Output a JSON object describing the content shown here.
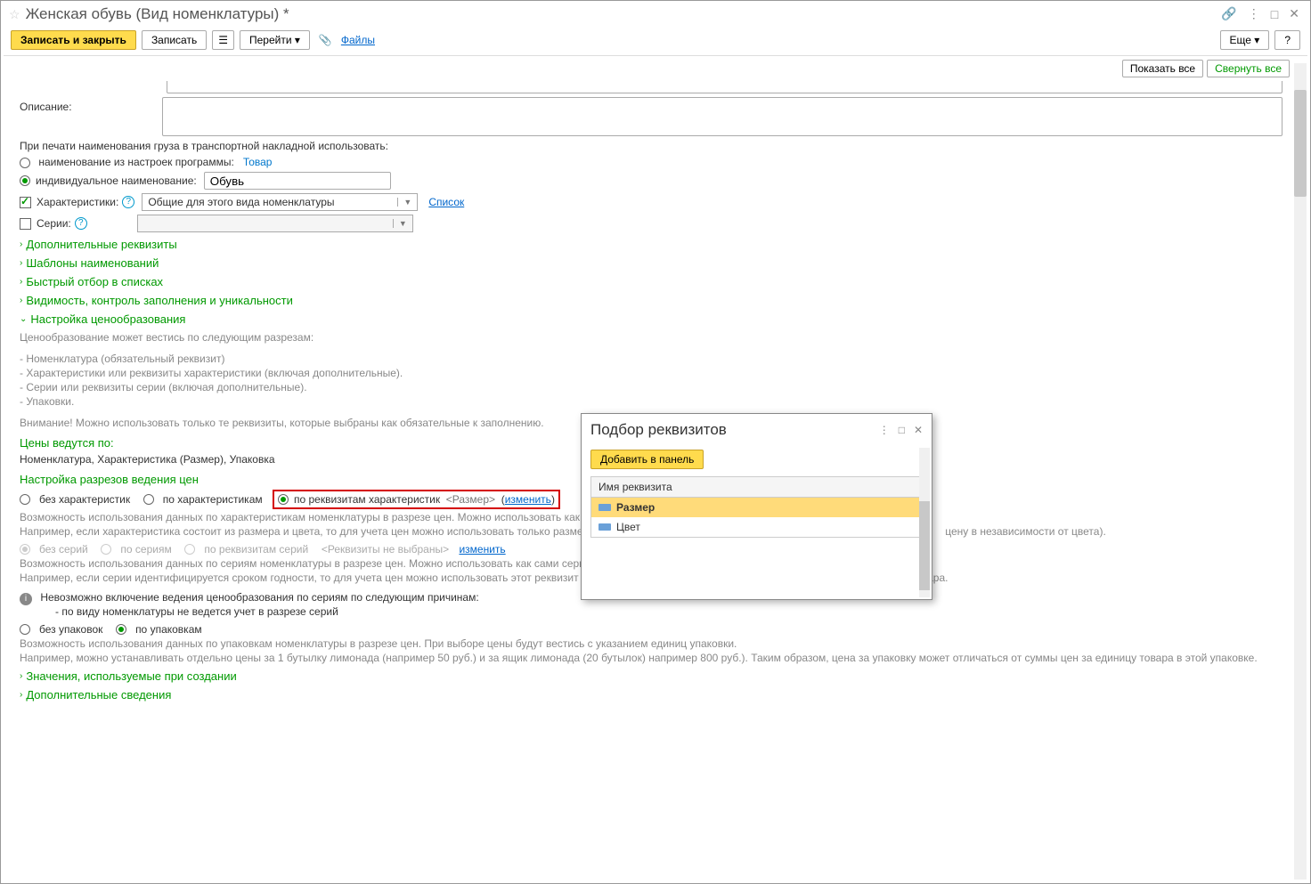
{
  "title": "Женская обувь (Вид номенклатуры) *",
  "toolbar": {
    "save_close": "Записать и закрыть",
    "save": "Записать",
    "goto": "Перейти",
    "files": "Файлы",
    "more": "Еще"
  },
  "secondbar": {
    "show_all": "Показать все",
    "collapse_all": "Свернуть все"
  },
  "labels": {
    "description": "Описание:",
    "print_note": "При печати наименования груза в транспортной накладной использовать:",
    "from_program": "наименование из настроек программы:",
    "tovar": "Товар",
    "individual": "индивидуальное наименование:",
    "individual_value": "Обувь",
    "characteristics": "Характеристики:",
    "characteristics_value": "Общие для этого вида номенклатуры",
    "list": "Список",
    "series": "Серии:"
  },
  "sections": {
    "s1": "Дополнительные реквизиты",
    "s2": "Шаблоны наименований",
    "s3": "Быстрый отбор в списках",
    "s4": "Видимость, контроль заполнения и уникальности",
    "s5": "Настройка ценообразования",
    "s6": "Значения, используемые при создании",
    "s7": "Дополнительные сведения"
  },
  "pricing": {
    "intro": "Ценообразование может вестись по следующим разрезам:",
    "bul1": "- Номенклатура (обязательный реквизит)",
    "bul2": "- Характеристики или реквизиты характеристики (включая дополнительные).",
    "bul3": "- Серии или реквизиты серии (включая дополнительные).",
    "bul4": "- Упаковки.",
    "warn": "Внимание! Можно использовать только те реквизиты, которые выбраны как обязательные к заполнению.",
    "prices_by": "Цены ведутся по:",
    "prices_by_value": "Номенклатура, Характеристика (Размер), Упаковка",
    "slice_header": "Настройка разрезов ведения цен",
    "r1": "без характеристик",
    "r2": "по характеристикам",
    "r3": "по реквизитам характеристик",
    "r3_value": "<Размер>",
    "change": "изменить",
    "desc1a": "Возможность использования данных по характеристикам номенклатуры в разрезе цен. Можно использовать как с",
    "desc1b": "Например, если характеристика состоит из размера и цвета, то для учета цен можно использовать только размер",
    "desc1c": "цену в независимости от цвета).",
    "s_r1": "без серий",
    "s_r2": "по сериям",
    "s_r3": "по реквизитам серий",
    "s_r3_value": "<Реквизиты не выбраны>",
    "desc2a": "Возможность использования данных по сериям номенклатуры в разрезе цен. Можно использовать как сами серии, так и их реквизиты.",
    "desc2b": "Например, если серии идентифицируется сроком годности, то для учета цен можно использовать этот реквизит (ценами можно будет управлять в зависимости от срока годности товара.",
    "info_head": "Невозможно включение ведения ценообразования по сериям по следующим причинам:",
    "info_line": "- по виду номенклатуры не ведется учет в разрезе серий",
    "p_r1": "без упаковок",
    "p_r2": "по упаковкам",
    "desc3a": "Возможность использования данных по упаковкам номенклатуры в разрезе цен. При выборе цены будут вестись с указанием единиц упаковки.",
    "desc3b": "Например, можно устанавливать отдельно цены за 1 бутылку лимонада (например 50 руб.) и за ящик лимонада (20 бутылок) например 800 руб.). Таким образом, цена за упаковку может отличаться от суммы цен за единицу товара в этой упаковке."
  },
  "popup": {
    "title": "Подбор реквизитов",
    "add": "Добавить в панель",
    "column": "Имя реквизита",
    "row1": "Размер",
    "row2": "Цвет"
  }
}
